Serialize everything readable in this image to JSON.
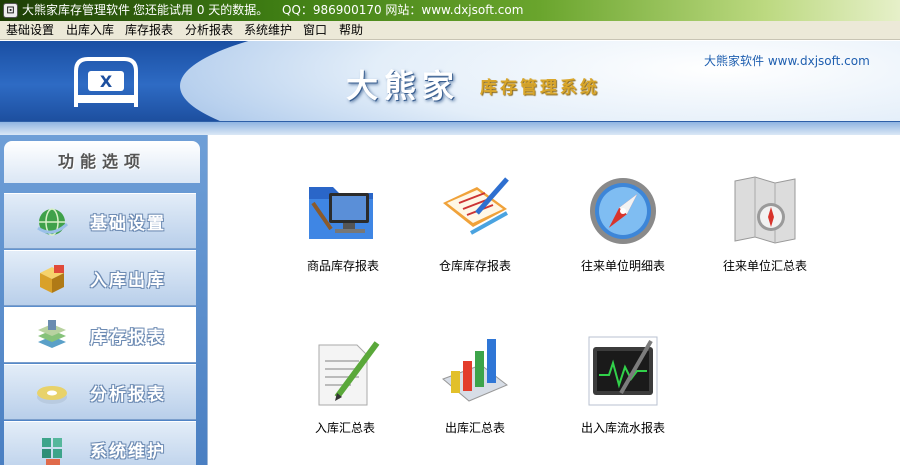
{
  "titlebar": {
    "app_name": "大熊家库存管理软件",
    "trial": "您还能试用 0 天的数据。",
    "contact": "QQ：986900170 网站：www.dxjsoft.com"
  },
  "menu": [
    "基础设置",
    "出库入库",
    "库存报表",
    "分析报表",
    "系统维护",
    "窗口",
    "帮助"
  ],
  "banner": {
    "brand": "大熊家",
    "subtitle": "库存管理系统",
    "site": "大熊家软件 www.dxjsoft.com"
  },
  "sidebar": {
    "header": "功能选项",
    "items": [
      {
        "label": "基础设置",
        "icon": "globe-icon"
      },
      {
        "label": "入库出库",
        "icon": "box-icon"
      },
      {
        "label": "库存报表",
        "icon": "layers-icon",
        "active": true
      },
      {
        "label": "分析报表",
        "icon": "disc-icon"
      },
      {
        "label": "系统维护",
        "icon": "tools-icon"
      }
    ]
  },
  "tiles": [
    {
      "label": "商品库存报表",
      "icon": "computer-folder-icon"
    },
    {
      "label": "仓库库存报表",
      "icon": "clipboard-pencil-icon"
    },
    {
      "label": "往来单位明细表",
      "icon": "compass-icon"
    },
    {
      "label": "往来单位汇总表",
      "icon": "map-compass-icon"
    },
    {
      "label": "入库汇总表",
      "icon": "document-pen-icon"
    },
    {
      "label": "出库汇总表",
      "icon": "bar-chart-icon"
    },
    {
      "label": "出入库流水报表",
      "icon": "monitor-pen-icon"
    }
  ],
  "colors": {
    "banner_blue": "#1a4fa3",
    "gold": "#d9a62a",
    "title_green": "#3e7c13"
  }
}
